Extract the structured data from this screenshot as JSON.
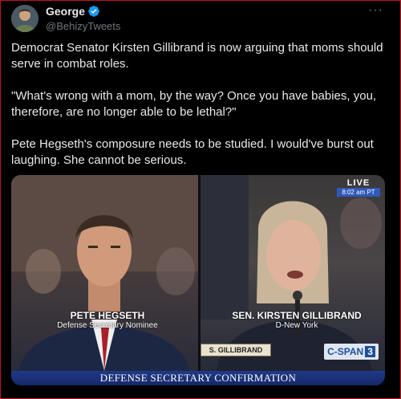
{
  "user": {
    "name": "George",
    "handle": "@BehizyTweets"
  },
  "tweet": {
    "paragraphs": [
      "Democrat Senator Kirsten Gillibrand is now arguing that moms should serve in combat roles.",
      "\"What's wrong with a mom, by the way? Once you have babies, you, therefore, are no longer able to be lethal?\"",
      "Pete Hegseth's composure needs to be studied. I would've burst out laughing. She cannot be serious."
    ]
  },
  "media": {
    "left_caption_name": "PETE HEGSETH",
    "left_caption_title": "Defense Secretary Nominee",
    "right_caption_name": "SEN. KIRSTEN GILLIBRAND",
    "right_caption_title": "D-New York",
    "live_label": "LIVE",
    "live_time": "8:02 am PT",
    "nameplate": "S. GILLIBRAND",
    "network": "C-SPAN",
    "network_number": "3",
    "banner": "DEFENSE SECRETARY CONFIRMATION"
  },
  "icons": {
    "verified": "verified-badge-icon",
    "more": "more-options-icon"
  },
  "colors": {
    "accent_blue": "#1d9bf0",
    "frame_red": "#c0141b",
    "banner_blue": "#1f3a86"
  }
}
